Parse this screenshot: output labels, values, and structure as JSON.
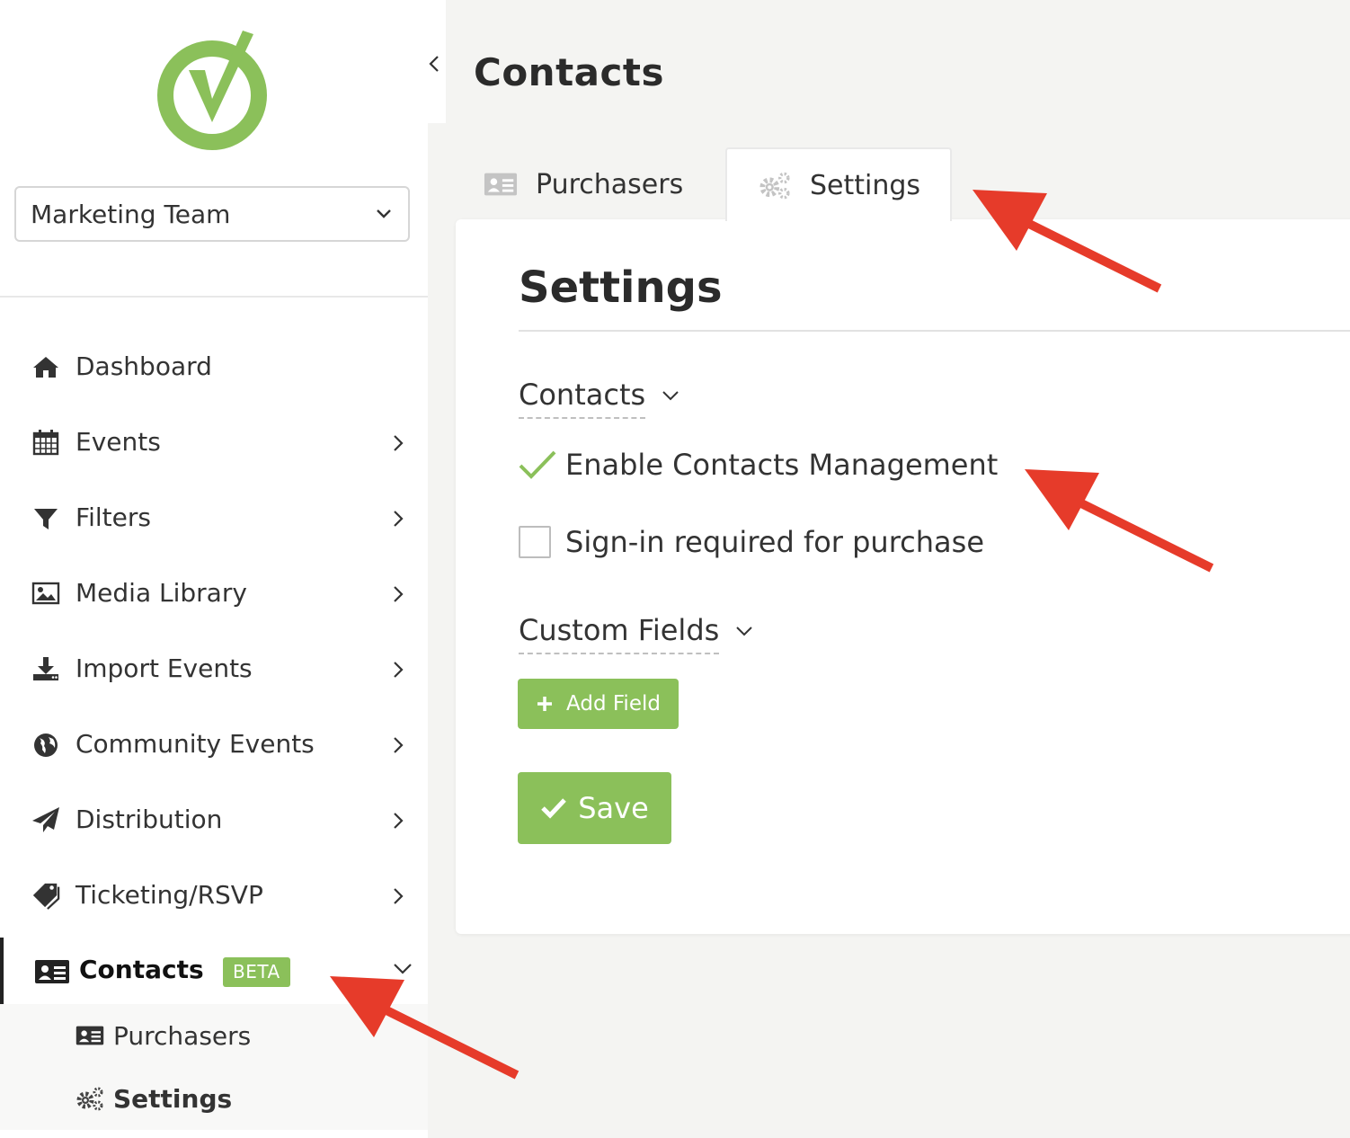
{
  "team_select": {
    "value": "Marketing Team"
  },
  "sidebar": {
    "items": [
      {
        "label": "Dashboard",
        "icon": "home-icon"
      },
      {
        "label": "Events",
        "icon": "calendar-icon"
      },
      {
        "label": "Filters",
        "icon": "filter-icon"
      },
      {
        "label": "Media Library",
        "icon": "image-icon"
      },
      {
        "label": "Import Events",
        "icon": "download-icon"
      },
      {
        "label": "Community Events",
        "icon": "globe-icon"
      },
      {
        "label": "Distribution",
        "icon": "paper-plane-icon"
      },
      {
        "label": "Ticketing/RSVP",
        "icon": "tags-icon"
      }
    ],
    "contacts": {
      "label": "Contacts",
      "badge": "BETA",
      "sub_items": [
        {
          "label": "Purchasers",
          "icon": "contact-card-icon"
        },
        {
          "label": "Settings",
          "icon": "gears-icon"
        }
      ]
    }
  },
  "main": {
    "title": "Contacts",
    "tabs": [
      {
        "label": "Purchasers",
        "icon": "contact-card-icon"
      },
      {
        "label": "Settings",
        "icon": "gears-icon"
      }
    ],
    "panel": {
      "title": "Settings",
      "contacts_section": {
        "label": "Contacts",
        "options": [
          {
            "label": "Enable Contacts Management",
            "checked": true
          },
          {
            "label": "Sign-in required for purchase",
            "checked": false
          }
        ]
      },
      "custom_fields_section": {
        "label": "Custom Fields",
        "add_button": "Add Field"
      },
      "save_button": "Save"
    }
  },
  "colors": {
    "brand_green": "#8bc05a",
    "arrow_red": "#e63b2a",
    "page_bg": "#f4f4f2"
  }
}
